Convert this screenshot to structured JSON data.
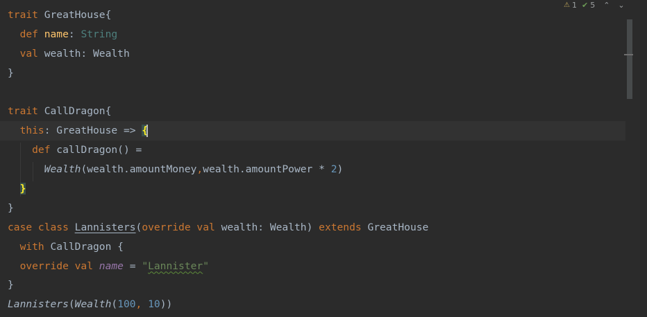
{
  "editor": {
    "inspections": {
      "warning_count": "1",
      "ok_count": "5"
    },
    "lines": [
      [
        {
          "t": "trait ",
          "c": "kw"
        },
        {
          "t": "GreatHouse{",
          "c": ""
        }
      ],
      [
        {
          "t": "  def ",
          "c": "kw"
        },
        {
          "t": "name",
          "c": "fn"
        },
        {
          "t": ": ",
          "c": ""
        },
        {
          "t": "String",
          "c": "ty"
        }
      ],
      [
        {
          "t": "  val ",
          "c": "kw"
        },
        {
          "t": "wealth: Wealth",
          "c": ""
        }
      ],
      [
        {
          "t": "}",
          "c": ""
        }
      ],
      [],
      [
        {
          "t": "trait ",
          "c": "kw"
        },
        {
          "t": "CallDragon{",
          "c": ""
        }
      ],
      [
        {
          "t": "  this",
          "c": "kw"
        },
        {
          "t": ": GreatHouse => ",
          "c": ""
        },
        {
          "t": "{",
          "c": "brace-hl"
        }
      ],
      [
        {
          "t": "    def ",
          "c": "kw"
        },
        {
          "t": "callDragon() =",
          "c": ""
        }
      ],
      [
        {
          "t": "      ",
          "c": ""
        },
        {
          "t": "Wealth",
          "c": "it"
        },
        {
          "t": "(wealth.amountMoney",
          "c": ""
        },
        {
          "t": ",",
          "c": "kw"
        },
        {
          "t": "wealth.amountPower * ",
          "c": ""
        },
        {
          "t": "2",
          "c": "num"
        },
        {
          "t": ")",
          "c": ""
        }
      ],
      [
        {
          "t": "  ",
          "c": ""
        },
        {
          "t": "}",
          "c": "brace-hl"
        }
      ],
      [
        {
          "t": "}",
          "c": ""
        }
      ],
      [
        {
          "t": "case class ",
          "c": "kw"
        },
        {
          "t": "Lannisters",
          "c": "underline"
        },
        {
          "t": "(",
          "c": ""
        },
        {
          "t": "override val ",
          "c": "kw"
        },
        {
          "t": "wealth: Wealth) ",
          "c": ""
        },
        {
          "t": "extends ",
          "c": "kw"
        },
        {
          "t": "GreatHouse",
          "c": ""
        }
      ],
      [
        {
          "t": "  ",
          "c": ""
        },
        {
          "t": "with ",
          "c": "kw"
        },
        {
          "t": "CallDragon {",
          "c": ""
        }
      ],
      [
        {
          "t": "  override val ",
          "c": "kw"
        },
        {
          "t": "name",
          "c": "purple"
        },
        {
          "t": " = ",
          "c": ""
        },
        {
          "t": "\"",
          "c": "str"
        },
        {
          "t": "Lannister",
          "c": "str squiggle"
        },
        {
          "t": "\"",
          "c": "str"
        }
      ],
      [
        {
          "t": "}",
          "c": ""
        }
      ],
      [
        {
          "t": "Lannisters",
          "c": "it"
        },
        {
          "t": "(",
          "c": ""
        },
        {
          "t": "Wealth",
          "c": "it"
        },
        {
          "t": "(",
          "c": ""
        },
        {
          "t": "100",
          "c": "num"
        },
        {
          "t": ", ",
          "c": "kw"
        },
        {
          "t": "10",
          "c": "num"
        },
        {
          "t": "))",
          "c": ""
        }
      ]
    ],
    "current_line": 6
  }
}
